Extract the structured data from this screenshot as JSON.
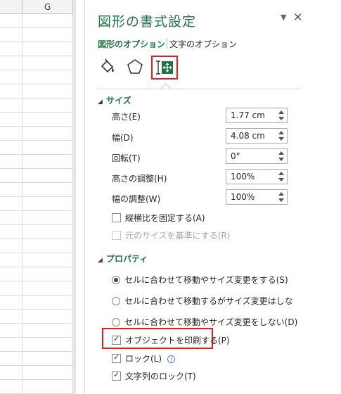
{
  "sheet": {
    "column_label": "G"
  },
  "pane": {
    "title": "図形の書式設定",
    "close_glyph": "×",
    "menu_glyph": "▼",
    "tabs": {
      "shape_options": "図形のオプション",
      "text_options": "文字のオプション"
    },
    "icons": [
      "fill-line-icon",
      "effects-icon",
      "size-properties-icon"
    ],
    "size_section": {
      "header": "サイズ",
      "height_label": "高さ(E)",
      "height_value": "1.77 cm",
      "width_label": "幅(D)",
      "width_value": "4.08 cm",
      "rotation_label": "回転(T)",
      "rotation_value": "0°",
      "scale_height_label": "高さの調整(H)",
      "scale_height_value": "100%",
      "scale_width_label": "幅の調整(W)",
      "scale_width_value": "100%",
      "lock_aspect_label": "縦横比を固定する(A)",
      "relative_original_label": "元のサイズを基準にする(R)"
    },
    "properties_section": {
      "header": "プロパティ",
      "radio_1": "セルに合わせて移動やサイズ変更をする(S)",
      "radio_2": "セルに合わせて移動するがサイズ変更はしな",
      "radio_3": "セルに合わせて移動やサイズ変更をしない(D)",
      "print_object_label": "オブジェクトを印刷する(P)",
      "locked_label": "ロック(L)",
      "lock_text_label": "文字列のロック(T)",
      "info_glyph": "i"
    }
  },
  "colors": {
    "accent_green": "#217346",
    "highlight_red": "#e02020"
  }
}
